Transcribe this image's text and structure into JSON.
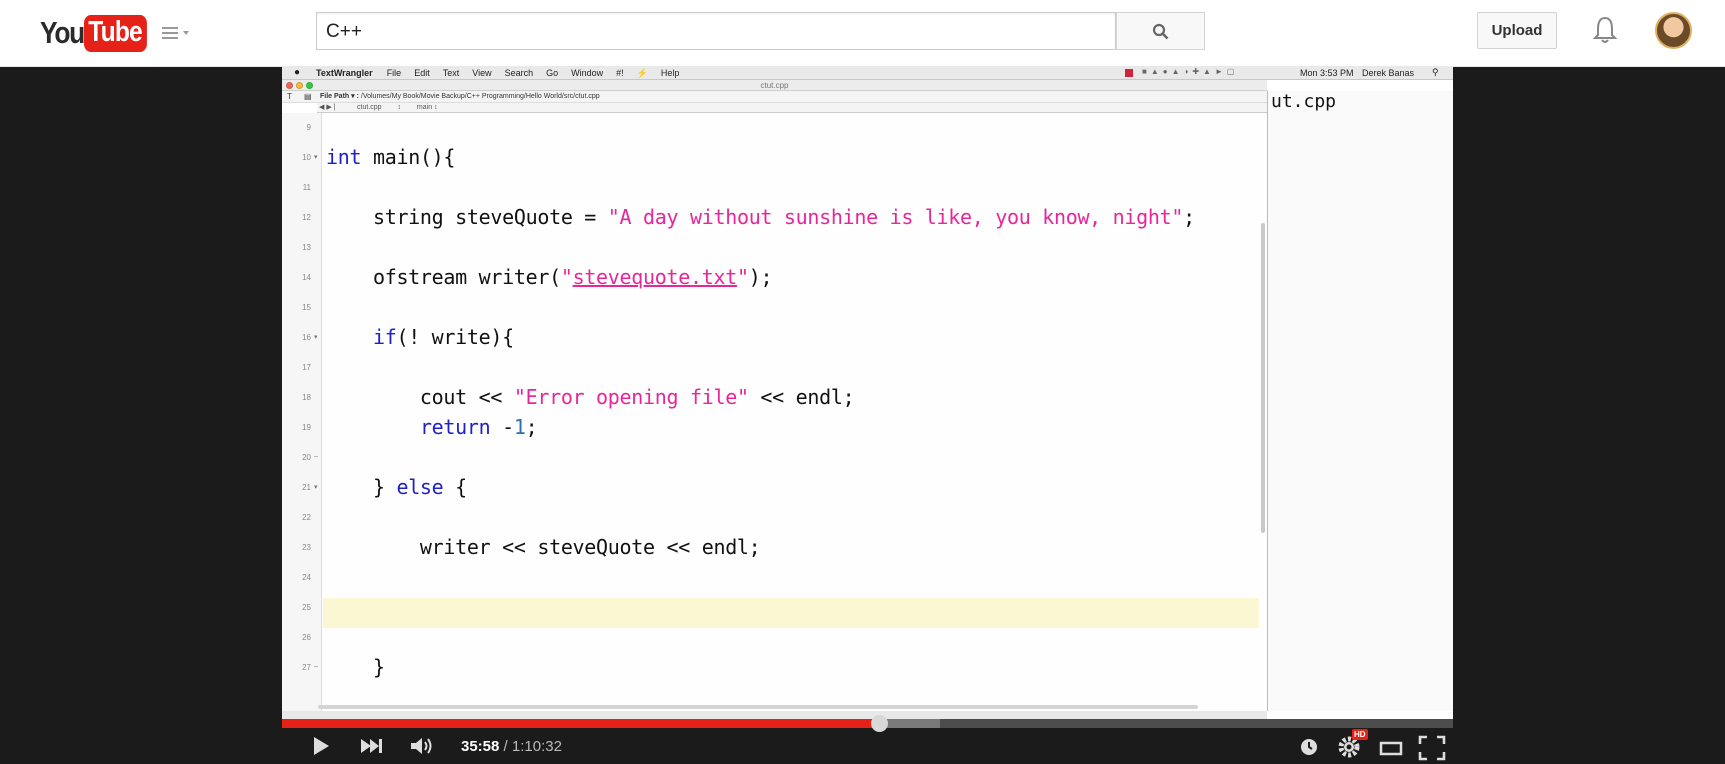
{
  "header": {
    "logo_you": "You",
    "logo_tube": "Tube",
    "search_value": "C++",
    "upload_label": "Upload"
  },
  "mac": {
    "app_name": "TextWrangler",
    "menus": [
      "File",
      "Edit",
      "Text",
      "View",
      "Search",
      "Go",
      "Window",
      "#!",
      "Help"
    ],
    "clock": "Mon 3:53 PM",
    "user": "Derek Banas",
    "window_title": "ctut.cpp",
    "file_path_label": "File Path ▾ :",
    "file_path": "/Volumes/My Book/Movie Backup/C++ Programming/Hello World/src/ctut.cpp",
    "nav_file": "ctut.cpp",
    "nav_func": "main"
  },
  "editor": {
    "line_numbers": [
      "9",
      "10",
      "11",
      "12",
      "13",
      "14",
      "15",
      "16",
      "17",
      "18",
      "19",
      "20",
      "21",
      "22",
      "23",
      "24",
      "25",
      "26",
      "27"
    ],
    "code": {
      "l10_kw": "int",
      "l10_rest": " main(){",
      "l12_a": "    string steveQuote = ",
      "l12_str": "\"A day without sunshine is like, you know, night\"",
      "l12_end": ";",
      "l14_a": "    ofstream writer(",
      "l14_q1": "\"",
      "l14_file": "stevequote.txt",
      "l14_q2": "\"",
      "l14_end": ");",
      "l16_pre": "    ",
      "l16_kw": "if",
      "l16_rest": "(! write){",
      "l18_a": "        cout << ",
      "l18_str": "\"Error opening file\"",
      "l18_end": " << endl;",
      "l19_pre": "        ",
      "l19_kw": "return",
      "l19_mid": " -",
      "l19_num": "1",
      "l19_end": ";",
      "l21_a": "    } ",
      "l21_kw": "else",
      "l21_end": " {",
      "l23": "        writer << steveQuote << endl;",
      "l27": "    }"
    },
    "background_window_text": "ut.cpp"
  },
  "player": {
    "current_time": "35:58",
    "separator": " / ",
    "duration": "1:10:32",
    "progress_fraction": 0.5101,
    "hd_badge": "HD",
    "colors": {
      "played": "#e62117",
      "buffered": "#7a7a7a"
    }
  },
  "icons": [
    "guide-menu-icon",
    "search-icon",
    "bell-icon",
    "play-icon",
    "next-icon",
    "volume-icon",
    "watch-later-icon",
    "settings-icon",
    "theater-icon",
    "fullscreen-icon"
  ]
}
